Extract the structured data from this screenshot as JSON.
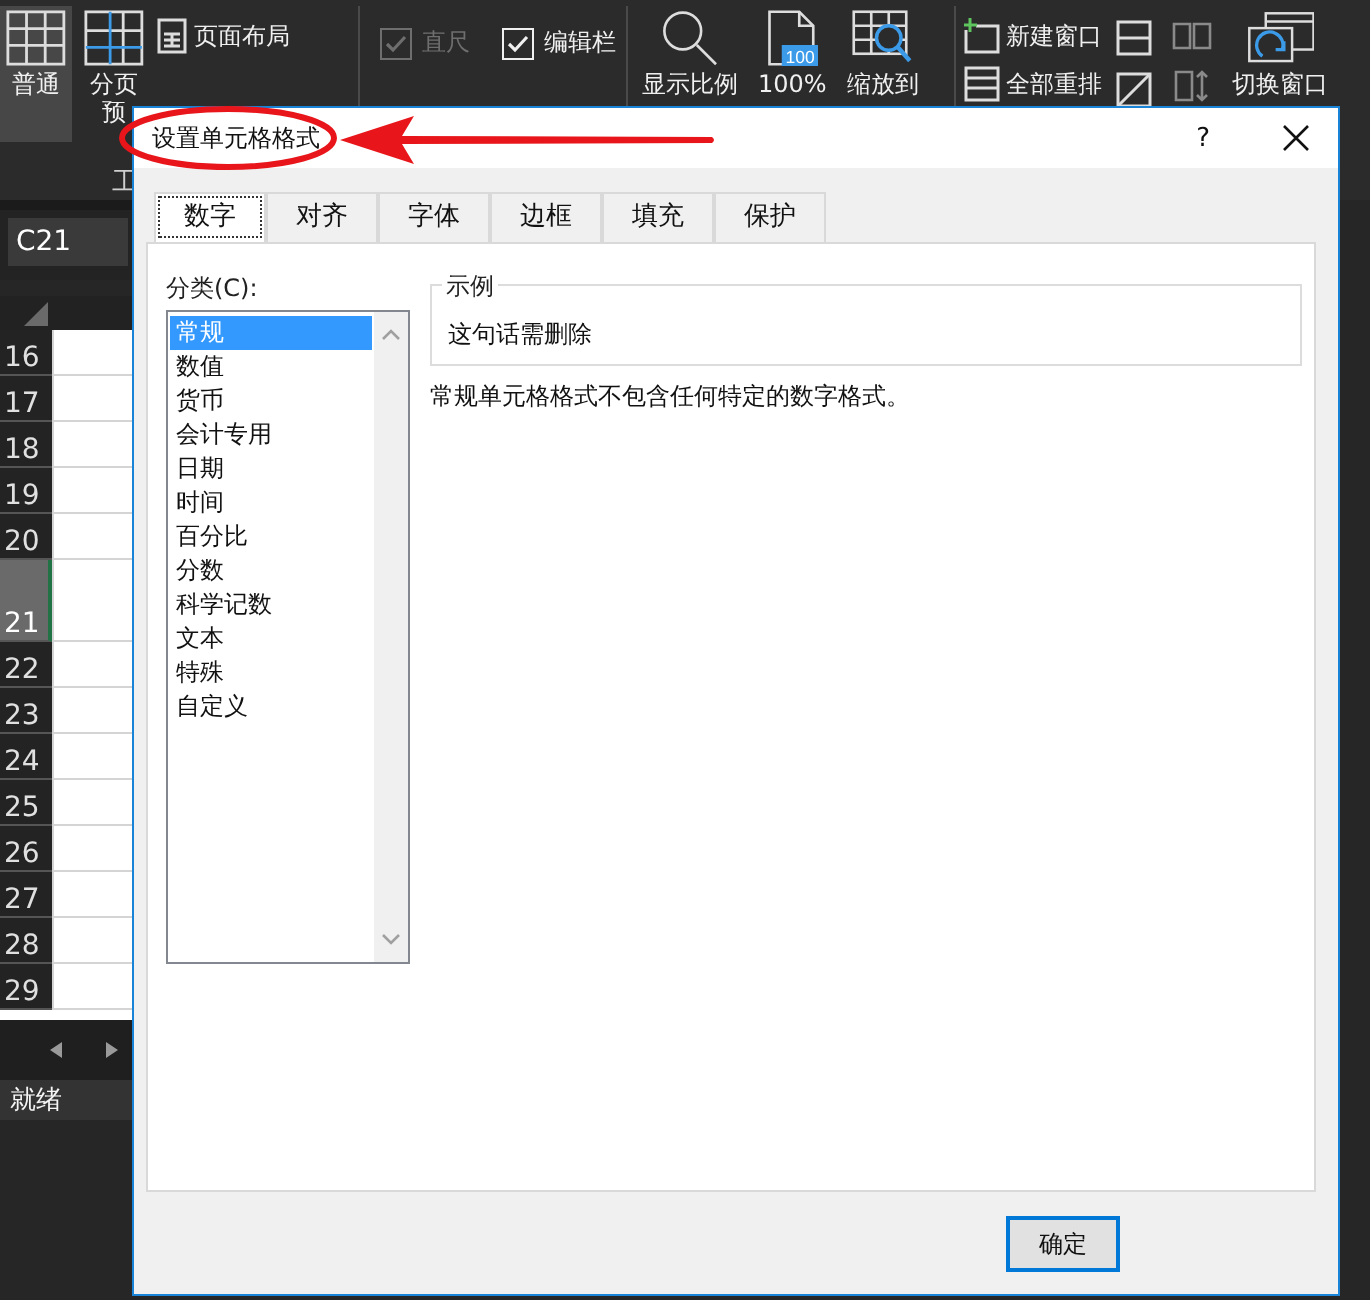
{
  "ribbon": {
    "groups": [
      {
        "label": "工",
        "items": [
          {
            "kind": "large",
            "label": "普通",
            "selected": true
          },
          {
            "kind": "large",
            "label": "分页预",
            "selected": false
          },
          {
            "kind": "small",
            "label": "页面布局"
          }
        ]
      },
      {
        "items": [
          {
            "kind": "checkbox",
            "label": "直尺",
            "checked": true,
            "disabled": true
          },
          {
            "kind": "checkbox",
            "label": "编辑栏",
            "checked": true,
            "disabled": false
          }
        ]
      },
      {
        "items": [
          {
            "kind": "large",
            "label": "显示比例"
          },
          {
            "kind": "large",
            "label": "100%",
            "badge": "100"
          },
          {
            "kind": "large",
            "label": "缩放到"
          }
        ]
      },
      {
        "items": [
          {
            "kind": "small",
            "label": "新建窗口"
          },
          {
            "kind": "small",
            "label": "全部重排"
          },
          {
            "kind": "icon"
          },
          {
            "kind": "icon"
          },
          {
            "kind": "icon",
            "disabled": true
          },
          {
            "kind": "icon",
            "disabled": true
          },
          {
            "kind": "large",
            "label": "切换窗口"
          }
        ]
      }
    ]
  },
  "name_box": "C21",
  "rows": [
    {
      "label": "16",
      "selected": false
    },
    {
      "label": "17",
      "selected": false
    },
    {
      "label": "18",
      "selected": false
    },
    {
      "label": "19",
      "selected": false
    },
    {
      "label": "20",
      "selected": false
    },
    {
      "label": "21",
      "selected": true
    },
    {
      "label": "22",
      "selected": false
    },
    {
      "label": "23",
      "selected": false
    },
    {
      "label": "24",
      "selected": false
    },
    {
      "label": "25",
      "selected": false
    },
    {
      "label": "26",
      "selected": false
    },
    {
      "label": "27",
      "selected": false
    },
    {
      "label": "28",
      "selected": false
    },
    {
      "label": "29",
      "selected": false
    }
  ],
  "status_bar": {
    "text": "就绪"
  },
  "dialog": {
    "title": "设置单元格格式",
    "help": "?",
    "tabs": [
      {
        "label": "数字",
        "selected": true
      },
      {
        "label": "对齐",
        "selected": false
      },
      {
        "label": "字体",
        "selected": false
      },
      {
        "label": "边框",
        "selected": false
      },
      {
        "label": "填充",
        "selected": false
      },
      {
        "label": "保护",
        "selected": false
      }
    ],
    "category_label": "分类(C):",
    "categories": [
      {
        "label": "常规",
        "selected": true
      },
      {
        "label": "数值",
        "selected": false
      },
      {
        "label": "货币",
        "selected": false
      },
      {
        "label": "会计专用",
        "selected": false
      },
      {
        "label": "日期",
        "selected": false
      },
      {
        "label": "时间",
        "selected": false
      },
      {
        "label": "百分比",
        "selected": false
      },
      {
        "label": "分数",
        "selected": false
      },
      {
        "label": "科学记数",
        "selected": false
      },
      {
        "label": "文本",
        "selected": false
      },
      {
        "label": "特殊",
        "selected": false
      },
      {
        "label": "自定义",
        "selected": false
      }
    ],
    "sample": {
      "legend": "示例",
      "text": "这句话需删除"
    },
    "description": "常规单元格格式不包含任何特定的数字格式。",
    "buttons": [
      "确定"
    ]
  }
}
